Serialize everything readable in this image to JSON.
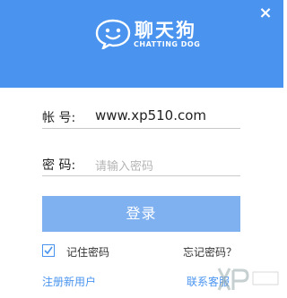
{
  "header": {
    "app_name": "聊天狗",
    "app_subtitle": "CHATTING DOG",
    "close_glyph": "×",
    "bg_color": "#4a94f0"
  },
  "form": {
    "account_label": "帐 号:",
    "account_value": "www.xp510.com",
    "password_label": "密 码:",
    "password_placeholder": "请输入密码",
    "login_button": "登录",
    "login_color": "#7fb1f0"
  },
  "options": {
    "remember_label": "记住密码",
    "remember_checked": true,
    "forgot_link": "忘记密码？"
  },
  "footer": {
    "register_link": "注册新用户",
    "contact_link": "联系客服"
  },
  "icons": {
    "logo": "chat-bubble-dog-icon",
    "close": "close-icon",
    "check": "check-icon"
  }
}
